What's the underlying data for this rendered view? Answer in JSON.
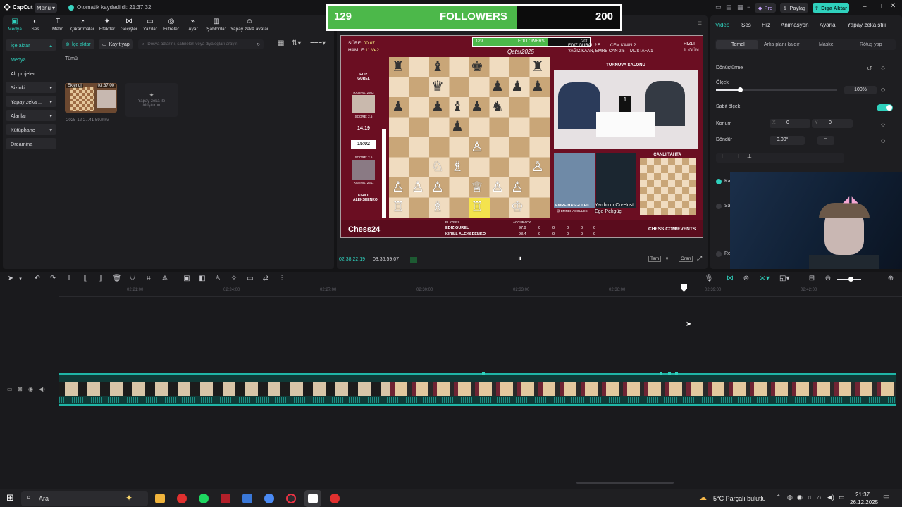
{
  "app": {
    "name": "CapCut",
    "menu_label": "Menü",
    "autosave_text": "Otomatik kaydedildi: 21:37:32"
  },
  "header_right": {
    "pro": "Pro",
    "share": "Paylaş",
    "export": "Dışa Aktar"
  },
  "colors": {
    "accent": "#2fd1bd",
    "bg": "#141416",
    "panel": "#1e1e21",
    "follower_fill": "#4cb84a",
    "track": "#1fb5a6",
    "video_bg": "#6b0e22"
  },
  "toolbar": {
    "items": [
      {
        "label": "Medya",
        "icon": "media-icon"
      },
      {
        "label": "Ses",
        "icon": "audio-icon"
      },
      {
        "label": "Metin",
        "icon": "text-icon"
      },
      {
        "label": "Çıkartmalar",
        "icon": "sticker-icon"
      },
      {
        "label": "Efektler",
        "icon": "effects-icon"
      },
      {
        "label": "Geçişler",
        "icon": "transitions-icon"
      },
      {
        "label": "Yazılar",
        "icon": "captions-icon"
      },
      {
        "label": "Ayar",
        "icon": "adjust-icon"
      },
      {
        "label": "Filtreler",
        "icon": "filters-icon"
      },
      {
        "label": "Şablonlar",
        "icon": "templates-icon"
      },
      {
        "label": "Yapay zekâ avatar",
        "icon": "ai-avatar-icon"
      }
    ]
  },
  "sidebar": {
    "items": [
      {
        "label": "İçe aktar"
      },
      {
        "label": "Medya"
      },
      {
        "label": "Alt projeler"
      },
      {
        "label": "Sizinki"
      },
      {
        "label": "Yapay zeka ..."
      },
      {
        "label": "Alanlar"
      },
      {
        "label": "Kütüphane"
      },
      {
        "label": "Dreamina"
      }
    ]
  },
  "media": {
    "import_button": "İçe aktar",
    "record_button": "Kayıt yap",
    "search_placeholder": "Dosya adlarını, sahneleri veya diyalogları arayın",
    "filter_all": "Tümü",
    "clip": {
      "badge": "Eklendi",
      "duration": "03:37:00",
      "filename": "2025-12-2...41-59.mkv"
    },
    "ai_create": "Yapay zekâ ile oluşturun"
  },
  "followers_bar": {
    "current": "129",
    "label": "FOLLOWERS",
    "goal": "200",
    "progress": 0.645
  },
  "video": {
    "sure_label": "SÜRE:",
    "sure_value": "00:07",
    "hamle_label": "HAMLE:",
    "hamle_value": "11.Ve2",
    "event_logo": "Qatar2025",
    "standings": [
      "EDIZ GURAL 2.5",
      "CEM KAAN 2",
      "YAĞIZ KAAN, EMRE CAN 2.5",
      "MUSTAFA 1"
    ],
    "speed_label": "HIZLI",
    "day_label": "1. GÜN",
    "player1": {
      "name": "EDIZ GUREL",
      "score": "SCORE: 2.5",
      "rating": "RATING: 2502",
      "clock": "14:19"
    },
    "player2": {
      "name": "KIRILL ALEKSEENKO",
      "score": "SCORE: 2.5",
      "rating": "RATING: 2611",
      "clock": "15:02"
    },
    "hall_title": "TURNUVA SALONU",
    "live_board_title": "CANLI TAHTA",
    "commentator": "EMRE HASGULEC",
    "commentator_handle": "@ EMREHASGULEC",
    "cohost": "Yardımcı Co-Host Ege Pekgüç",
    "brand": "Chess24",
    "site": "CHESS.COM/EVENTS",
    "table_headers": [
      "PLAYERS",
      "ACCURACY"
    ],
    "table_rows": [
      {
        "name": "EDIZ GUREL",
        "acc": "97.9",
        "vals": [
          "0",
          "0",
          "0",
          "0",
          "0"
        ]
      },
      {
        "name": "KIRILL ALEKSEENKO",
        "acc": "98.4",
        "vals": [
          "0",
          "0",
          "0",
          "0",
          "0"
        ]
      }
    ],
    "mini_followers": {
      "current": "129",
      "label": "FOLLOWERS",
      "goal": "200"
    }
  },
  "player_controls": {
    "current_time": "02:38:22:19",
    "total_time": "03:36:59:07",
    "full": "Tam",
    "ratio": "Oran"
  },
  "right_panel": {
    "tabs": [
      "Video",
      "Ses",
      "Hız",
      "Animasyon",
      "Ayarla",
      "Yapay zeka stili"
    ],
    "subtabs": [
      "Temel",
      "Arka planı kaldır",
      "Maske",
      "Rötuş yap"
    ],
    "transform_title": "Dönüştürme",
    "scale_label": "Ölçek",
    "scale_value": "100%",
    "scale_progress": 0.2,
    "uniform_scale": "Sabit ölçek",
    "position_label": "Konum",
    "pos_x_label": "X",
    "pos_x": "0",
    "pos_y_label": "Y",
    "pos_y": "0",
    "rotate_label": "Döndür",
    "rotate_value": "0.00°",
    "check_items": [
      "Ka",
      "Sa",
      "Re"
    ]
  },
  "timeline": {
    "ruler": [
      "02:21:00",
      "02:24:00",
      "02:27:00",
      "02:30:00",
      "02:33:00",
      "02:36:00",
      "02:39:00",
      "02:42:00"
    ]
  },
  "taskbar": {
    "search_placeholder": "Ara",
    "weather": "5°C  Parçalı bulutlu",
    "time": "21:37",
    "date": "26.12.2025"
  }
}
